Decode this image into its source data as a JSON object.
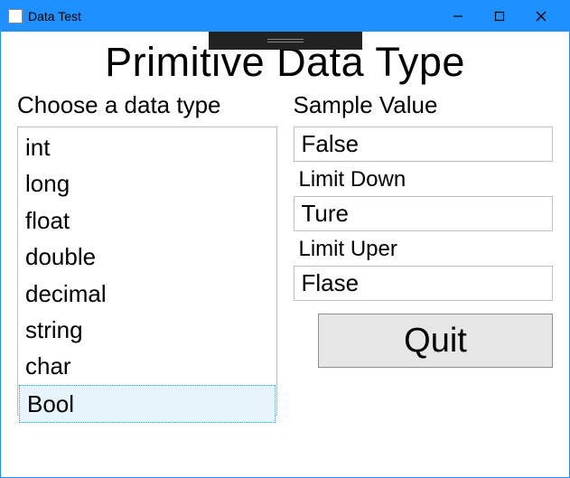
{
  "window": {
    "title": "Data Test"
  },
  "heading": "Primitive Data Type",
  "left": {
    "label": "Choose a data type",
    "items": [
      "int",
      "long",
      "float",
      "double",
      "decimal",
      "string",
      "char",
      "Bool"
    ],
    "selected_index": 7
  },
  "right": {
    "sample_label": "Sample Value",
    "sample_value": "False",
    "limit_down_label": "Limit Down",
    "limit_down_value": "Ture",
    "limit_upper_label": "Limit Uper",
    "limit_upper_value": "Flase"
  },
  "quit_label": "Quit"
}
